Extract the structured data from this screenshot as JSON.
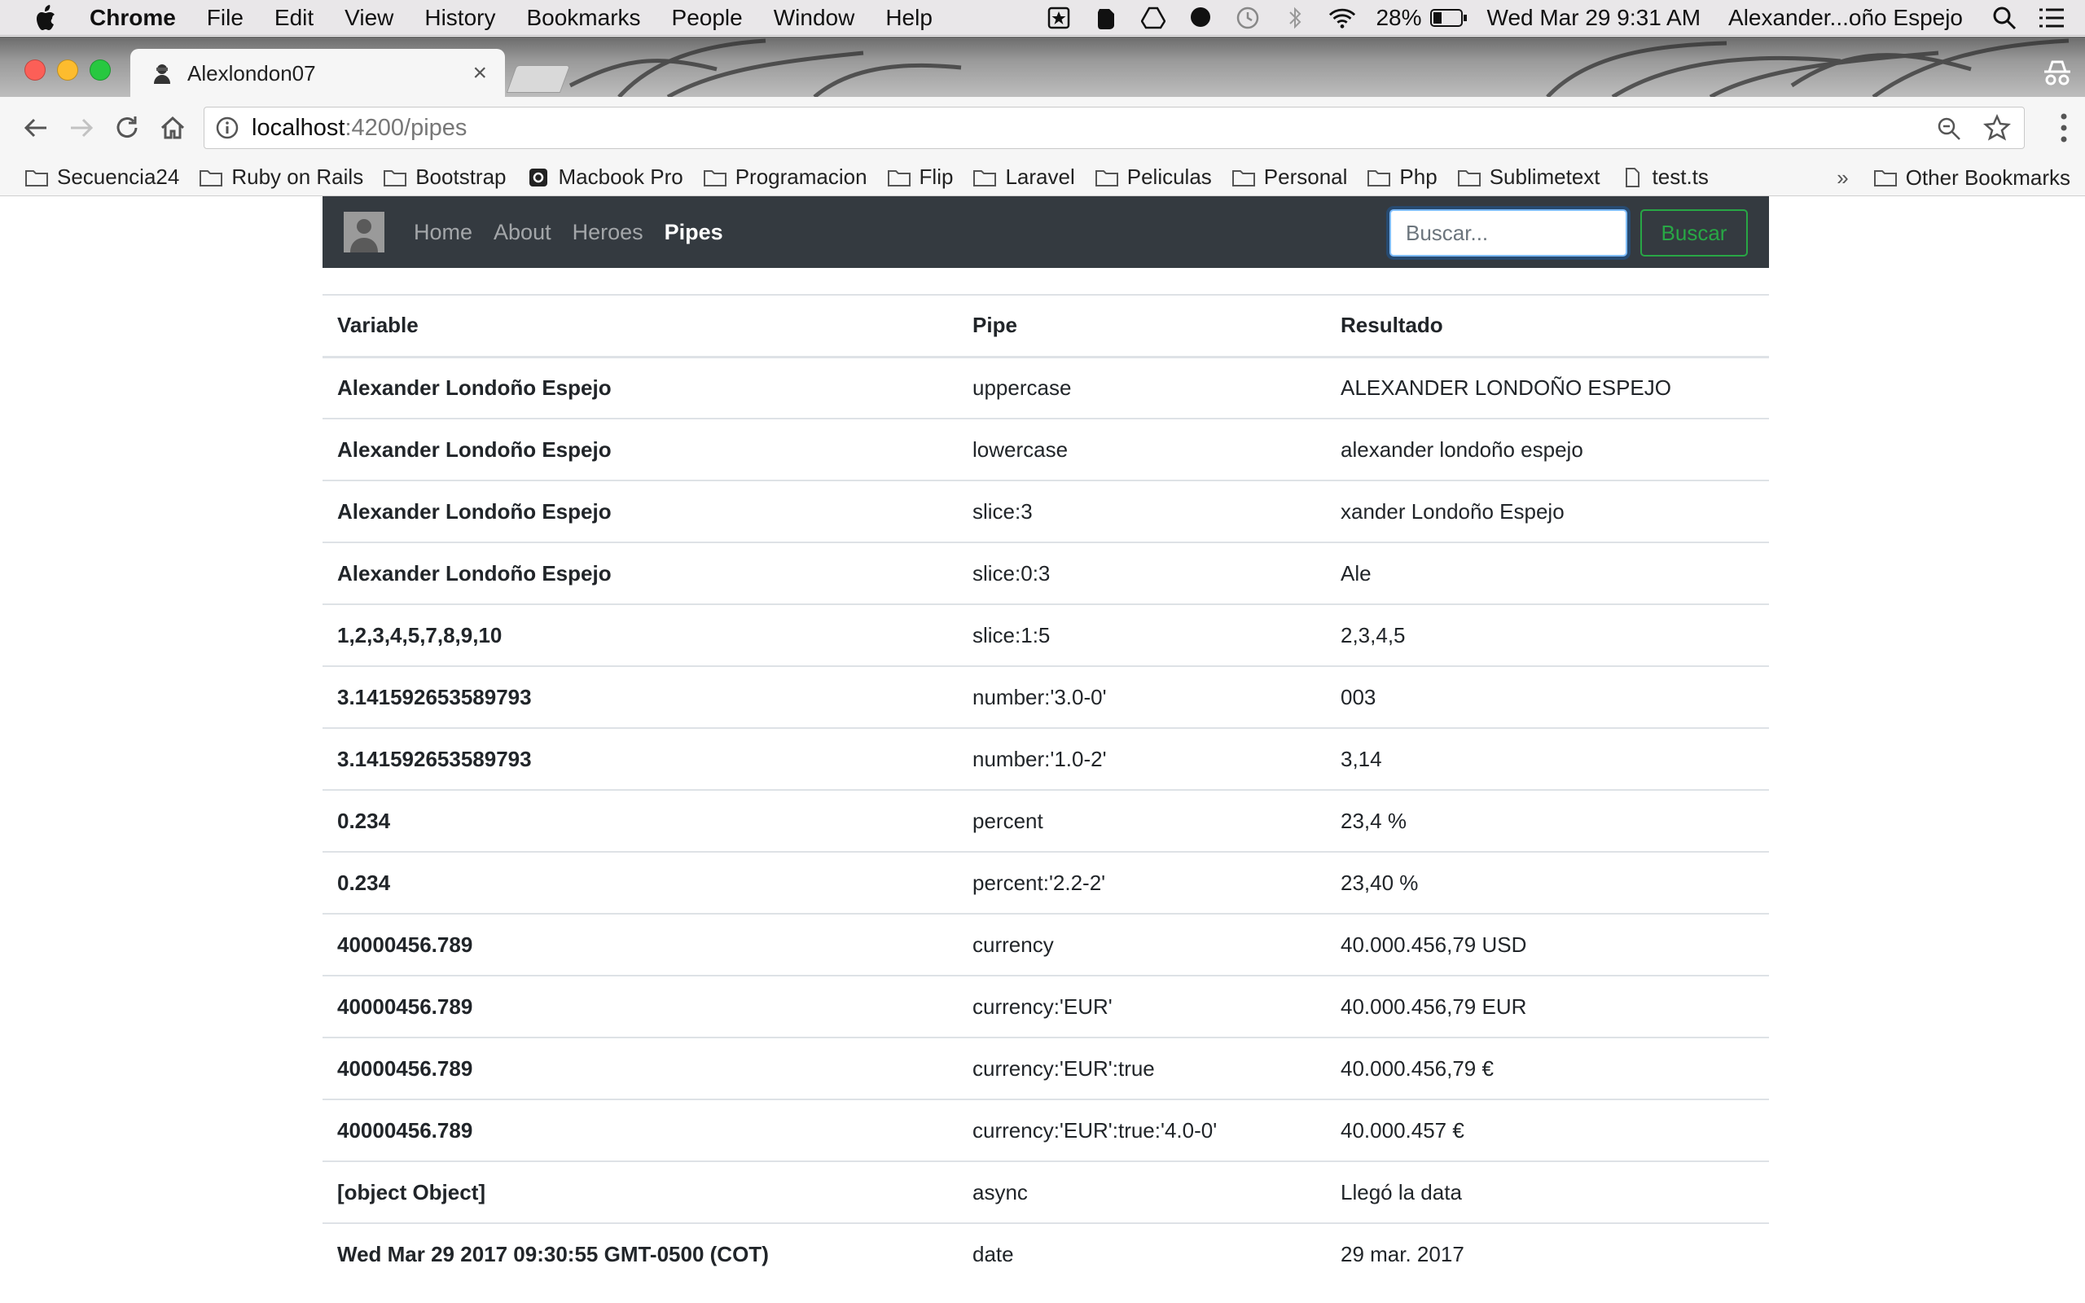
{
  "menubar": {
    "app": "Chrome",
    "items": [
      "File",
      "Edit",
      "View",
      "History",
      "Bookmarks",
      "People",
      "Window",
      "Help"
    ],
    "battery": "28%",
    "datetime": "Wed Mar 29  9:31 AM",
    "user": "Alexander...oño Espejo"
  },
  "browser": {
    "tab_title": "Alexlondon07",
    "url_host": "localhost",
    "url_path": ":4200/pipes",
    "bookmarks": [
      "Secuencia24",
      "Ruby on Rails",
      "Bootstrap",
      "Macbook Pro",
      "Programacion",
      "Flip",
      "Laravel",
      "Peliculas",
      "Personal",
      "Php",
      "Sublimetext",
      "test.ts"
    ],
    "more_bookmarks": "»",
    "other_bookmarks": "Other Bookmarks"
  },
  "navbar": {
    "links": [
      "Home",
      "About",
      "Heroes",
      "Pipes"
    ],
    "search_placeholder": "Buscar...",
    "search_button": "Buscar"
  },
  "table": {
    "headers": [
      "Variable",
      "Pipe",
      "Resultado"
    ],
    "rows": [
      [
        "Alexander Londoño Espejo",
        "uppercase",
        "ALEXANDER LONDOÑO ESPEJO"
      ],
      [
        "Alexander Londoño Espejo",
        "lowercase",
        "alexander londoño espejo"
      ],
      [
        "Alexander Londoño Espejo",
        "slice:3",
        "xander Londoño Espejo"
      ],
      [
        "Alexander Londoño Espejo",
        "slice:0:3",
        "Ale"
      ],
      [
        "1,2,3,4,5,7,8,9,10",
        "slice:1:5",
        "2,3,4,5"
      ],
      [
        "3.141592653589793",
        "number:'3.0-0'",
        "003"
      ],
      [
        "3.141592653589793",
        "number:'1.0-2'",
        "3,14"
      ],
      [
        "0.234",
        "percent",
        "23,4 %"
      ],
      [
        "0.234",
        "percent:'2.2-2'",
        "23,40 %"
      ],
      [
        "40000456.789",
        "currency",
        "40.000.456,79 USD"
      ],
      [
        "40000456.789",
        "currency:'EUR'",
        "40.000.456,79 EUR"
      ],
      [
        "40000456.789",
        "currency:'EUR':true",
        "40.000.456,79 €"
      ],
      [
        "40000456.789",
        "currency:'EUR':true:'4.0-0'",
        "40.000.457 €"
      ],
      [
        "[object Object]",
        "async",
        "Llegó la data"
      ],
      [
        "Wed Mar 29 2017 09:30:55 GMT-0500 (COT)",
        "date",
        "29 mar. 2017"
      ]
    ]
  }
}
